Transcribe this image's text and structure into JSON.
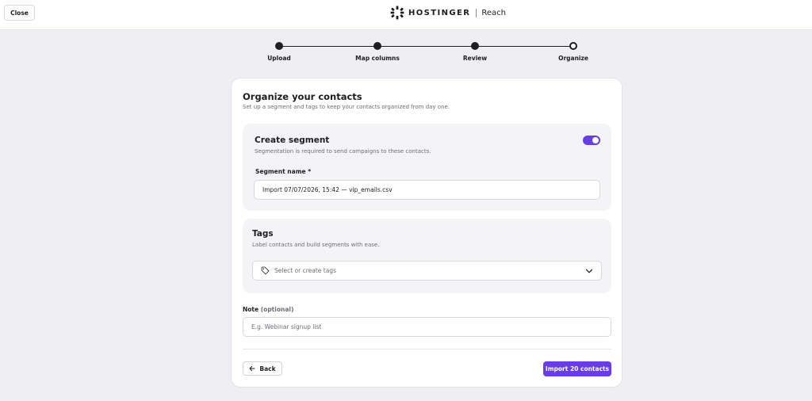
{
  "header": {
    "close_label": "Close",
    "brand_name": "HOSTINGER",
    "product_name": "Reach",
    "logo_icon": "hostinger-logo-icon"
  },
  "stepper": {
    "steps": [
      {
        "label": "Upload",
        "state": "completed"
      },
      {
        "label": "Map columns",
        "state": "completed"
      },
      {
        "label": "Review",
        "state": "completed"
      },
      {
        "label": "Organize",
        "state": "current"
      }
    ]
  },
  "organize": {
    "title": "Organize your contacts",
    "subtitle": "Set up a segment and tags to keep your contacts organized from day one."
  },
  "segment": {
    "title": "Create segment",
    "description": "Segmentation is required to send campaigns to these contacts.",
    "toggle_on": true,
    "name_label": "Segment name",
    "required_mark": "*",
    "name_value": "Import 07/07/2026, 15:42 — vip_emails.csv"
  },
  "tags": {
    "title": "Tags",
    "description": "Label contacts and build segments with ease.",
    "placeholder": "Select or create tags",
    "icon": "tag-icon"
  },
  "note": {
    "label": "Note",
    "optional": "(optional)",
    "placeholder": "E.g. Webinar signup list"
  },
  "footer": {
    "back_label": "Back",
    "import_label": "Import 20 contacts"
  },
  "colors": {
    "accent": "#673de6",
    "background": "#efeff3",
    "text": "#1d1e20"
  }
}
